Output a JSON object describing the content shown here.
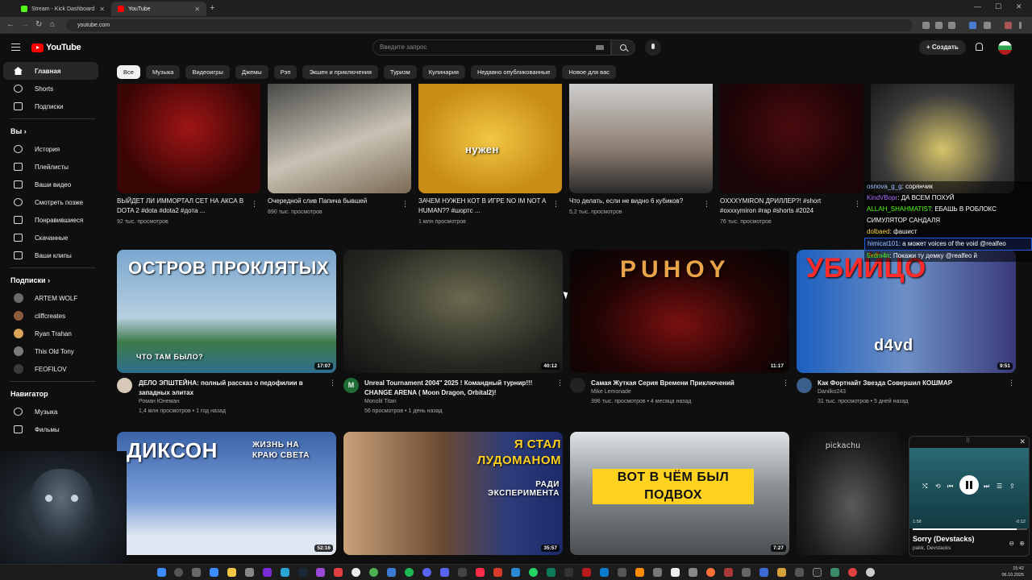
{
  "browser": {
    "tabs": [
      {
        "title": "Stream - Kick Dashboard",
        "favicon_color": "#53fc18"
      },
      {
        "title": "YouTube",
        "favicon_color": "#ff0000"
      }
    ],
    "new_tab": "+",
    "url": "youtube.com"
  },
  "header": {
    "logo_text": "YouTube",
    "search_placeholder": "Введите запрос",
    "create_label": "Создать",
    "create_icon": "+"
  },
  "sidebar": {
    "main": [
      {
        "label": "Главная",
        "icon": "home-icon"
      },
      {
        "label": "Shorts",
        "icon": "shorts-icon"
      },
      {
        "label": "Подписки",
        "icon": "subscriptions-icon"
      }
    ],
    "you_header": "Вы",
    "you_items": [
      {
        "label": "История",
        "icon": "history-icon"
      },
      {
        "label": "Плейлисты",
        "icon": "playlists-icon"
      },
      {
        "label": "Ваши видео",
        "icon": "your-videos-icon"
      },
      {
        "label": "Смотреть позже",
        "icon": "watch-later-icon"
      },
      {
        "label": "Понравившиеся",
        "icon": "liked-icon"
      },
      {
        "label": "Скачанные",
        "icon": "downloads-icon"
      },
      {
        "label": "Ваши клипы",
        "icon": "clips-icon"
      }
    ],
    "subs_header": "Подписки",
    "subs": [
      {
        "label": "ARTEM WOLF",
        "color": "#6b6b6b"
      },
      {
        "label": "cliffcreates",
        "color": "#8a5a3a"
      },
      {
        "label": "Ryan Trahan",
        "color": "#d9a35a"
      },
      {
        "label": "This Old Tony",
        "color": "#7a7a7a"
      },
      {
        "label": "FEOFILOV",
        "color": "#3a3a3a"
      }
    ],
    "nav_header": "Навигатор",
    "nav_items": [
      {
        "label": "Музыка",
        "icon": "music-icon"
      },
      {
        "label": "Фильмы",
        "icon": "movies-icon"
      }
    ],
    "chevron": "›"
  },
  "chips": [
    "Все",
    "Музыка",
    "Видеоигры",
    "Джемы",
    "Рэп",
    "Экшен и приключения",
    "Туризм",
    "Кулинария",
    "Недавно опубликованные",
    "Новое для вас"
  ],
  "shorts": [
    {
      "title": "ВЫЙДЕТ ЛИ ИММОРТАЛ СЕТ НА АКСА В DOTA 2 #dota #dota2 #дота ...",
      "views": "92 тыс. просмотров"
    },
    {
      "title": "Очередной слив Папича бывшей",
      "views": "890 тыс. просмотров"
    },
    {
      "title": "ЗАЧЕМ НУЖЕН КОТ В ИГРЕ NO IM NOT A HUMAN?? #шортс ...",
      "views": "1 млн просмотров",
      "overlay": "нужен"
    },
    {
      "title": "Что делать, если не видно 6 кубиков?",
      "views": "5,2 тыс. просмотров"
    },
    {
      "title": "OXXXYMIRON ДРИЛЛЕР?! #short #oxxxymiron #rap #shorts #2024",
      "views": "76 тыс. просмотров"
    }
  ],
  "videos_row1": [
    {
      "title": "ДЕЛО ЭПШТЕЙНА: полный рассказ о педофилии в западных элитах",
      "channel": "Роман Юнеман",
      "meta": "1,4 млн просмотров • 1 год назад",
      "duration": "17:07",
      "thumb_text": "ОСТРОВ ПРОКЛЯТЫХ",
      "thumb_sub": "ЧТО ТАМ БЫЛО?"
    },
    {
      "title": "Unreal Tournament 2004\" 2025 ! Командный турнир!!! CHANGE ARENA ( Moon Dragon, Orbital2)!",
      "channel": "Monolit Titan",
      "meta": "56 просмотров • 1 день назад",
      "duration": "40:12",
      "avatar_letter": "M"
    },
    {
      "title": "Самая Жуткая Серия Времени Приключений",
      "channel": "Mike Lemonade",
      "meta": "396 тыс. просмотров • 4 месяца назад",
      "duration": "11:17",
      "thumb_text": "PUHOY"
    },
    {
      "title": "Как Фортнайт Звезда Совершил КОШМАР",
      "channel": "Danilko243",
      "meta": "31 тыс. просмотров • 5 дней назад",
      "duration": "9:51",
      "thumb_text": "УБИЙЦО",
      "thumb_sub": "d4vd"
    }
  ],
  "videos_row2": [
    {
      "duration": "52:16",
      "thumb_text": "ДИКСОН",
      "thumb_sub": "ЖИЗНЬ НА КРАЮ СВЕТА"
    },
    {
      "duration": "35:57",
      "thumb_text": "Я СТАЛ ЛУДОМАНОМ",
      "thumb_sub": "РАДИ ЭКСПЕРИМЕНТА"
    },
    {
      "duration": "7:27",
      "thumb_text": "ВОТ В ЧЁМ БЫЛ ПОДВОХ"
    },
    {
      "thumb_text": "pickachu"
    }
  ],
  "chat": [
    {
      "user": "osnova_g_g",
      "text": "сорянчик",
      "color": "#9ec3ff"
    },
    {
      "user": "KindVBopr",
      "text": "ДА ВСЕМ ПОХУЙ",
      "color": "#a970ff"
    },
    {
      "user": "ALLAH_SHAHMATIST",
      "text": "ЕБАШЬ В РОБЛОКС",
      "color": "#53fc18"
    },
    {
      "user": "",
      "text": "СИМУЛЯТОР САНДАЛЯ",
      "color": "#ffffff"
    },
    {
      "user": "dolbaed",
      "text": "фашист",
      "color": "#f5d547"
    },
    {
      "user": "himicat101",
      "text": "а может voices of the void @realfeo",
      "color": "#9ec3ff",
      "highlight": true
    },
    {
      "user": "5xdm4n",
      "text": "Покажи ту демку @realfeo й",
      "color": "#53fc18"
    }
  ],
  "player": {
    "title": "Sorry (Devstacks)",
    "artist": "pakk, Devstacks",
    "elapsed": "1:58",
    "remaining": "-0:12",
    "progress": 0.91
  },
  "taskbar": {
    "time": "15:42",
    "date": "06.10.2025"
  }
}
